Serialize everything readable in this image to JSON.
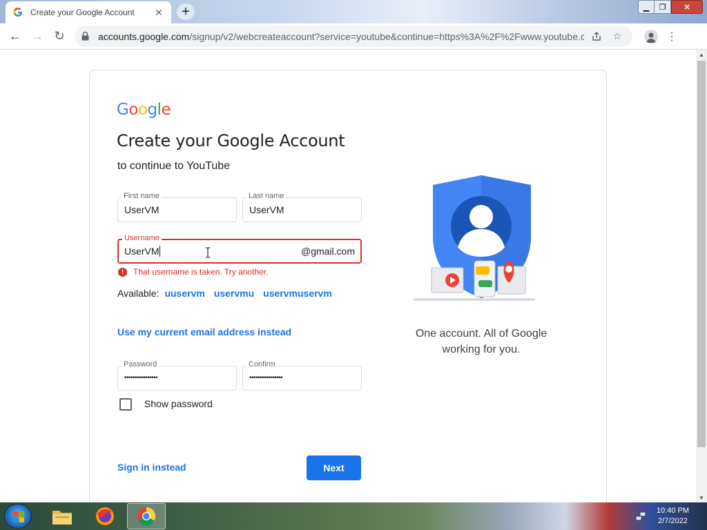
{
  "browser": {
    "tab": {
      "title": "Create your Google Account",
      "close": "✕"
    },
    "new_tab": "+",
    "window": {
      "minimize": "▁",
      "maximize": "❐",
      "close": "✕"
    },
    "nav": {
      "back": "←",
      "forward": "→",
      "reload": "↻"
    },
    "url": {
      "host": "accounts.google.com",
      "path": "/signup/v2/webcreateaccount?service=youtube&continue=https%3A%2F%2Fwww.youtube.com..."
    },
    "menu": "⋮"
  },
  "page": {
    "logo": {
      "letters": [
        "G",
        "o",
        "o",
        "g",
        "l",
        "e"
      ]
    },
    "title": "Create your Google Account",
    "subtitle": "to continue to YouTube",
    "first_name": {
      "label": "First name",
      "value": "UserVM"
    },
    "last_name": {
      "label": "Last name",
      "value": "UserVM"
    },
    "username": {
      "label": "Username",
      "value": "UserVM",
      "suffix": "@gmail.com"
    },
    "error": {
      "icon": "!",
      "text": "That username is taken. Try another."
    },
    "available": {
      "label": "Available:",
      "options": [
        "uuservm",
        "uservmu",
        "uservmuservm"
      ]
    },
    "use_email_link": "Use my current email address instead",
    "password": {
      "label": "Password",
      "value": "••••••••••••••••"
    },
    "confirm": {
      "label": "Confirm",
      "value": "••••••••••••••••"
    },
    "show_password": {
      "label": "Show password",
      "checked": false
    },
    "signin_link": "Sign in instead",
    "next_button": "Next",
    "tagline": {
      "line1": "One account. All of Google",
      "line2": "working for you."
    }
  },
  "colors": {
    "accent": "#1a73e8",
    "error": "#d93025",
    "google_blue": "#4285f4",
    "google_red": "#ea4335",
    "google_yellow": "#fbbc05",
    "google_green": "#34a853"
  },
  "taskbar": {
    "apps": [
      "file-explorer-icon",
      "firefox-icon",
      "chrome-icon"
    ],
    "clock": {
      "time": "10:40 PM",
      "date": "2/7/2022"
    }
  }
}
